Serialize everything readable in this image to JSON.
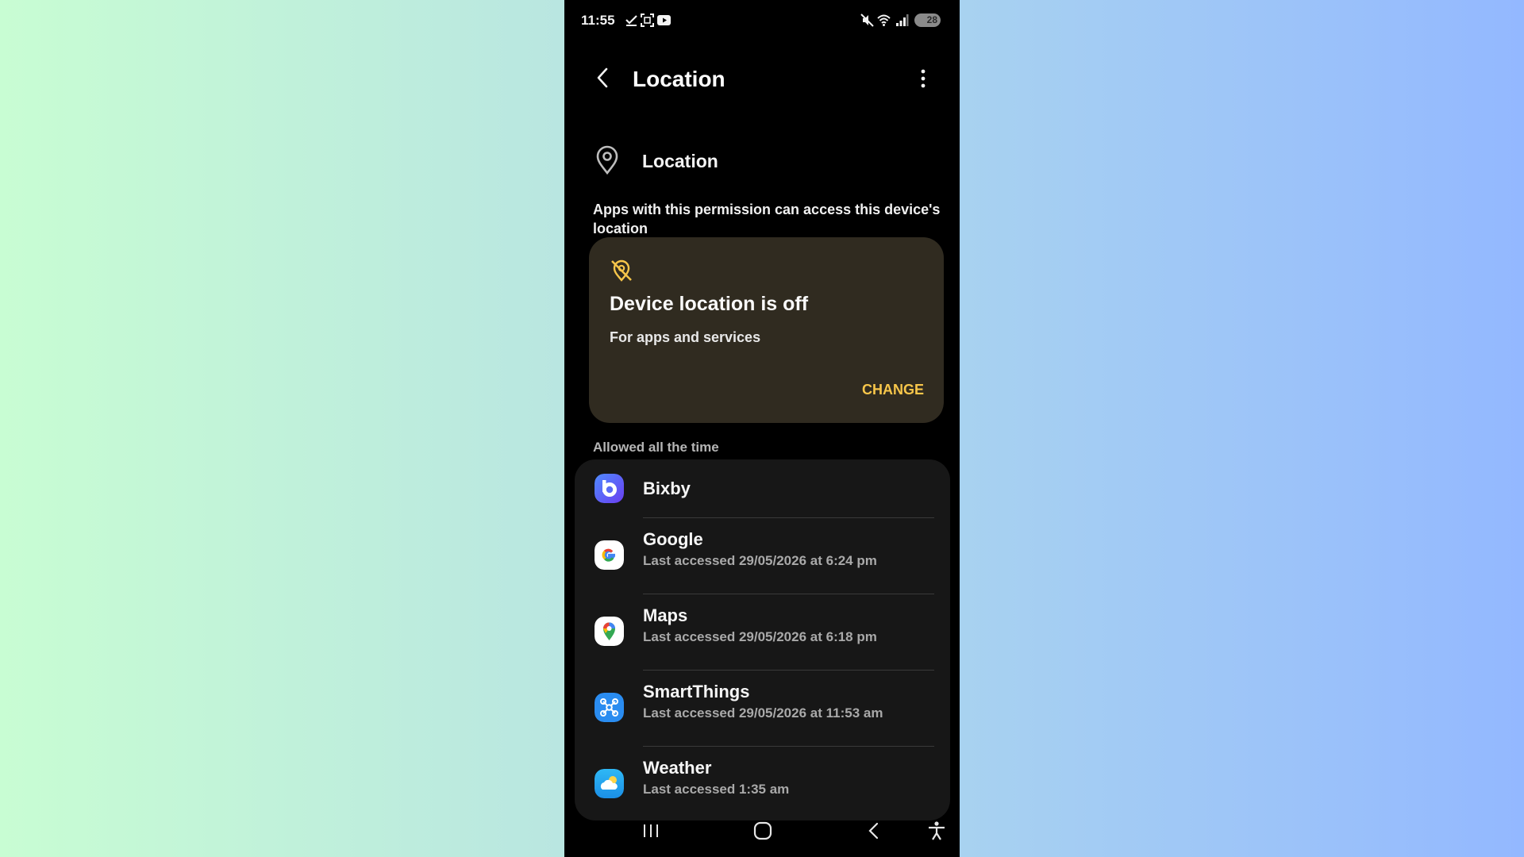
{
  "status_bar": {
    "time": "11:55",
    "battery": "28",
    "icons": [
      "check-icon",
      "screenshot-icon",
      "youtube-icon",
      "mute-icon",
      "wifi-icon",
      "signal-icon"
    ]
  },
  "app_bar": {
    "title": "Location"
  },
  "permission": {
    "title": "Location",
    "description": "Apps with this permission can access this device's location"
  },
  "warning_card": {
    "icon": "location-off-icon",
    "title": "Device location is off",
    "subtitle": "For apps and services",
    "action": "CHANGE",
    "accent_color": "#f7c64a",
    "background": "#302b20"
  },
  "section": {
    "header": "Allowed all the time"
  },
  "apps": [
    {
      "name": "Bixby",
      "detail": "",
      "icon": "bixby-icon"
    },
    {
      "name": "Google",
      "detail": "Last accessed 29/05/2026 at 6:24 pm",
      "icon": "google-icon"
    },
    {
      "name": "Maps",
      "detail": "Last accessed 29/05/2026 at 6:18 pm",
      "icon": "maps-icon"
    },
    {
      "name": "SmartThings",
      "detail": "Last accessed 29/05/2026 at 11:53 am",
      "icon": "smartthings-icon"
    },
    {
      "name": "Weather",
      "detail": "Last accessed 1:35 am",
      "icon": "weather-icon"
    }
  ],
  "nav_bar": {
    "buttons": [
      "recents-button",
      "home-button",
      "back-button",
      "accessibility-button"
    ]
  }
}
